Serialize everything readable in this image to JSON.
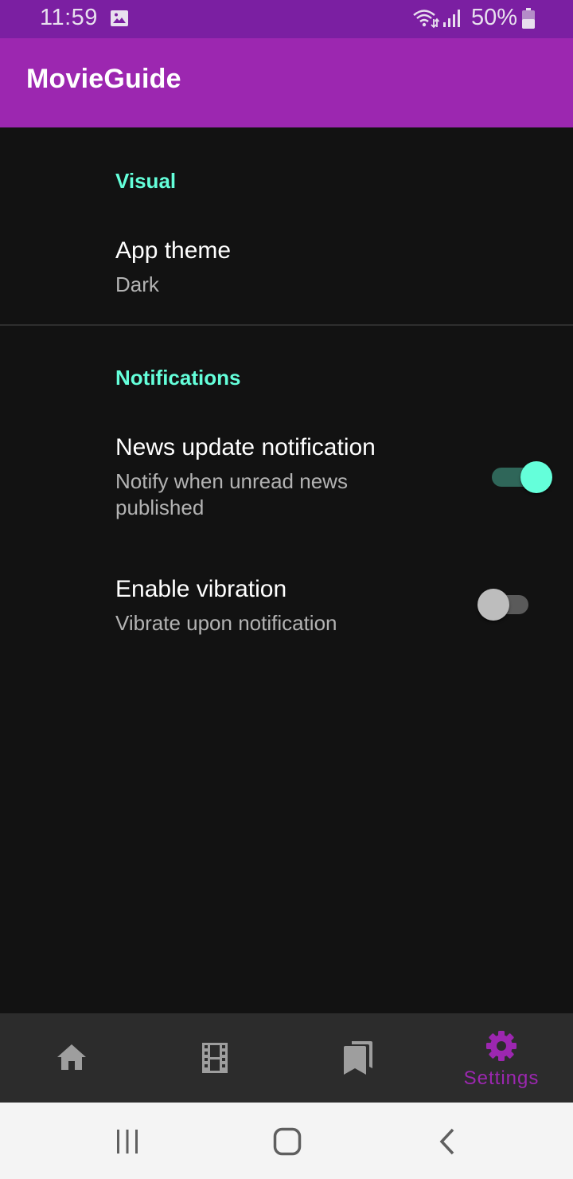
{
  "status_bar": {
    "time": "11:59",
    "battery_percent": "50%",
    "background_color": "#7b1fa2",
    "icons": [
      "image-icon",
      "wifi-icon",
      "signal-icon",
      "battery-icon"
    ]
  },
  "app_bar": {
    "title": "MovieGuide",
    "background_color": "#9c27b0"
  },
  "settings": {
    "sections": [
      {
        "title": "Visual",
        "items": [
          {
            "title": "App theme",
            "summary": "Dark"
          }
        ]
      },
      {
        "title": "Notifications",
        "items": [
          {
            "title": "News update notification",
            "summary": "Notify when unread news published",
            "switch_on": true
          },
          {
            "title": "Enable vibration",
            "summary": "Vibrate upon notification",
            "switch_on": false
          }
        ]
      }
    ],
    "accent_color": "#64ffda"
  },
  "bottom_nav": {
    "items": [
      {
        "icon": "home-icon",
        "label": "",
        "selected": false
      },
      {
        "icon": "film-icon",
        "label": "",
        "selected": false
      },
      {
        "icon": "bookmarks-icon",
        "label": "",
        "selected": false
      },
      {
        "icon": "gear-icon",
        "label": "Settings",
        "selected": true
      }
    ],
    "selected_color": "#9c27b0"
  },
  "system_nav": {
    "buttons": [
      "recents-icon",
      "home-circle-icon",
      "back-icon"
    ]
  }
}
